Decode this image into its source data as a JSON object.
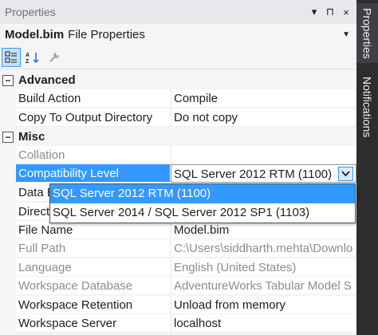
{
  "window": {
    "title": "Properties",
    "controls": [
      "▾",
      "⊓",
      "×"
    ]
  },
  "object_selector": {
    "name": "Model.bim",
    "type": "File Properties"
  },
  "categories": [
    {
      "label": "Advanced",
      "toggle": "−"
    },
    {
      "label": "Misc",
      "toggle": "−"
    }
  ],
  "properties": {
    "build_action": {
      "name": "Build Action",
      "value": "Compile"
    },
    "copy_to_output": {
      "name": "Copy To Output Directory",
      "value": "Do not copy"
    },
    "collation": {
      "name": "Collation",
      "value": ""
    },
    "compatibility_level": {
      "name": "Compatibility Level",
      "value": "SQL Server 2012 RTM (1100)"
    },
    "data_backup": {
      "name": "Data B",
      "value": ""
    },
    "directquery": {
      "name": "Direct",
      "value": ""
    },
    "file_name": {
      "name": "File Name",
      "value": "Model.bim"
    },
    "full_path": {
      "name": "Full Path",
      "value": "C:\\Users\\siddharth.mehta\\Downlo"
    },
    "language": {
      "name": "Language",
      "value": "English (United States)"
    },
    "workspace_database": {
      "name": "Workspace Database",
      "value": "AdventureWorks Tabular Model S"
    },
    "workspace_retention": {
      "name": "Workspace Retention",
      "value": "Unload from memory"
    },
    "workspace_server": {
      "name": "Workspace Server",
      "value": "localhost"
    }
  },
  "dropdown": {
    "options": [
      "SQL Server 2012 RTM (1100)",
      "SQL Server 2014 / SQL Server 2012 SP1 (1103)"
    ],
    "selected_index": 0
  },
  "side_tabs": [
    "Properties",
    "Notifications"
  ],
  "colors": {
    "selection": "#3399ff",
    "side_bar": "#2d2d30",
    "readonly_text": "#8d8d8d"
  }
}
